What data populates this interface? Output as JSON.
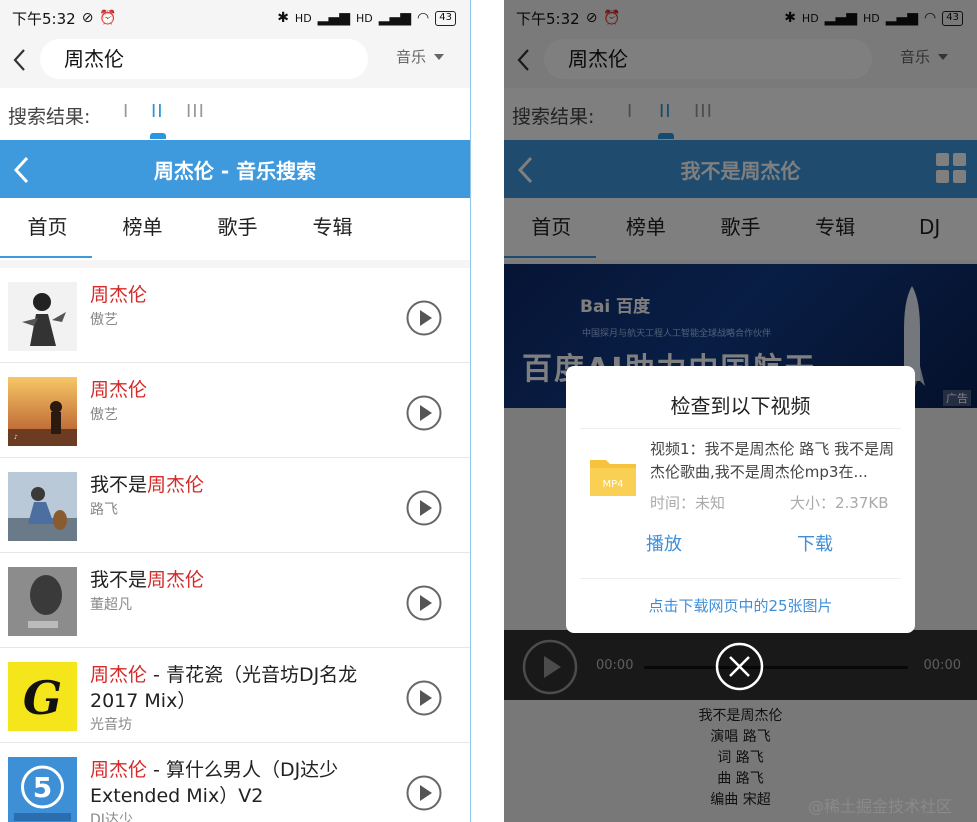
{
  "status": {
    "time": "下午5:32",
    "signal1": "HD",
    "signal2": "HD",
    "battery": "43"
  },
  "left": {
    "search_query": "周杰伦",
    "type_label": "音乐",
    "results_label": "搜索结果:",
    "modes": [
      "I",
      "II",
      "III"
    ],
    "header_title": "周杰伦 - 音乐搜索",
    "tabs": [
      "首页",
      "榜单",
      "歌手",
      "专辑"
    ],
    "songs": [
      {
        "hl": "周杰伦",
        "rest": "",
        "line2": "",
        "artist": "傲艺"
      },
      {
        "hl": "周杰伦",
        "rest": "",
        "line2": "",
        "artist": "傲艺"
      },
      {
        "pre": "我不是",
        "hl": "周杰伦",
        "line2": "",
        "artist": "路飞"
      },
      {
        "pre": "我不是",
        "hl": "周杰伦",
        "line2": "",
        "artist": "董超凡"
      },
      {
        "hl": "周杰伦",
        "rest": " - 青花瓷（光音坊DJ名龙",
        "line2": "2017 Mix）",
        "artist": "光音坊"
      },
      {
        "hl": "周杰伦",
        "rest": " - 算什么男人（DJ达少",
        "line2": "Extended Mix）V2",
        "artist": "DJ达少"
      }
    ]
  },
  "right": {
    "search_query": "周杰伦",
    "type_label": "音乐",
    "results_label": "搜索结果:",
    "modes": [
      "I",
      "II",
      "III"
    ],
    "header_title": "我不是周杰伦",
    "tabs": [
      "首页",
      "榜单",
      "歌手",
      "专辑",
      "DJ"
    ],
    "banner": {
      "logo": "Bai 百度",
      "subtitle": "中国探月与航天工程人工智能全球战略合作伙伴",
      "headline": "百度AI助力中国航天",
      "ad": "广告"
    },
    "player": {
      "time_start": "00:00",
      "time_end": "00:00"
    },
    "lyrics": [
      "我不是周杰伦",
      "演唱 路飞",
      "词 路飞",
      "曲 路飞",
      "编曲 宋超"
    ],
    "dialog": {
      "title": "检查到以下视频",
      "video_desc": "视频1：我不是周杰伦 路飞 我不是周杰伦歌曲,我不是周杰伦mp3在...",
      "time_label": "时间：未知",
      "size_label": "大小：2.37KB",
      "play_label": "播放",
      "download_label": "下载",
      "link_text": "点击下载网页中的25张图片",
      "folder_label": "MP4"
    }
  },
  "watermark": "@稀土掘金技术社区",
  "colors": {
    "accent": "#3f99dd",
    "highlight": "#d42a2a",
    "link": "#3f8fd8"
  }
}
